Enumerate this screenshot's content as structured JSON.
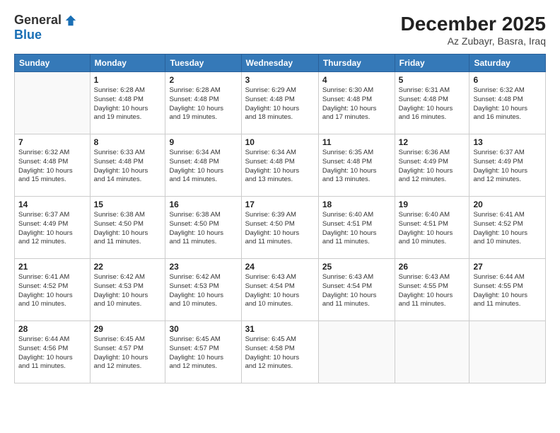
{
  "header": {
    "logo_general": "General",
    "logo_blue": "Blue",
    "month_title": "December 2025",
    "location": "Az Zubayr, Basra, Iraq"
  },
  "days_of_week": [
    "Sunday",
    "Monday",
    "Tuesday",
    "Wednesday",
    "Thursday",
    "Friday",
    "Saturday"
  ],
  "weeks": [
    [
      {
        "day": "",
        "info": ""
      },
      {
        "day": "1",
        "info": "Sunrise: 6:28 AM\nSunset: 4:48 PM\nDaylight: 10 hours\nand 19 minutes."
      },
      {
        "day": "2",
        "info": "Sunrise: 6:28 AM\nSunset: 4:48 PM\nDaylight: 10 hours\nand 19 minutes."
      },
      {
        "day": "3",
        "info": "Sunrise: 6:29 AM\nSunset: 4:48 PM\nDaylight: 10 hours\nand 18 minutes."
      },
      {
        "day": "4",
        "info": "Sunrise: 6:30 AM\nSunset: 4:48 PM\nDaylight: 10 hours\nand 17 minutes."
      },
      {
        "day": "5",
        "info": "Sunrise: 6:31 AM\nSunset: 4:48 PM\nDaylight: 10 hours\nand 16 minutes."
      },
      {
        "day": "6",
        "info": "Sunrise: 6:32 AM\nSunset: 4:48 PM\nDaylight: 10 hours\nand 16 minutes."
      }
    ],
    [
      {
        "day": "7",
        "info": "Sunrise: 6:32 AM\nSunset: 4:48 PM\nDaylight: 10 hours\nand 15 minutes."
      },
      {
        "day": "8",
        "info": "Sunrise: 6:33 AM\nSunset: 4:48 PM\nDaylight: 10 hours\nand 14 minutes."
      },
      {
        "day": "9",
        "info": "Sunrise: 6:34 AM\nSunset: 4:48 PM\nDaylight: 10 hours\nand 14 minutes."
      },
      {
        "day": "10",
        "info": "Sunrise: 6:34 AM\nSunset: 4:48 PM\nDaylight: 10 hours\nand 13 minutes."
      },
      {
        "day": "11",
        "info": "Sunrise: 6:35 AM\nSunset: 4:48 PM\nDaylight: 10 hours\nand 13 minutes."
      },
      {
        "day": "12",
        "info": "Sunrise: 6:36 AM\nSunset: 4:49 PM\nDaylight: 10 hours\nand 12 minutes."
      },
      {
        "day": "13",
        "info": "Sunrise: 6:37 AM\nSunset: 4:49 PM\nDaylight: 10 hours\nand 12 minutes."
      }
    ],
    [
      {
        "day": "14",
        "info": "Sunrise: 6:37 AM\nSunset: 4:49 PM\nDaylight: 10 hours\nand 12 minutes."
      },
      {
        "day": "15",
        "info": "Sunrise: 6:38 AM\nSunset: 4:50 PM\nDaylight: 10 hours\nand 11 minutes."
      },
      {
        "day": "16",
        "info": "Sunrise: 6:38 AM\nSunset: 4:50 PM\nDaylight: 10 hours\nand 11 minutes."
      },
      {
        "day": "17",
        "info": "Sunrise: 6:39 AM\nSunset: 4:50 PM\nDaylight: 10 hours\nand 11 minutes."
      },
      {
        "day": "18",
        "info": "Sunrise: 6:40 AM\nSunset: 4:51 PM\nDaylight: 10 hours\nand 11 minutes."
      },
      {
        "day": "19",
        "info": "Sunrise: 6:40 AM\nSunset: 4:51 PM\nDaylight: 10 hours\nand 10 minutes."
      },
      {
        "day": "20",
        "info": "Sunrise: 6:41 AM\nSunset: 4:52 PM\nDaylight: 10 hours\nand 10 minutes."
      }
    ],
    [
      {
        "day": "21",
        "info": "Sunrise: 6:41 AM\nSunset: 4:52 PM\nDaylight: 10 hours\nand 10 minutes."
      },
      {
        "day": "22",
        "info": "Sunrise: 6:42 AM\nSunset: 4:53 PM\nDaylight: 10 hours\nand 10 minutes."
      },
      {
        "day": "23",
        "info": "Sunrise: 6:42 AM\nSunset: 4:53 PM\nDaylight: 10 hours\nand 10 minutes."
      },
      {
        "day": "24",
        "info": "Sunrise: 6:43 AM\nSunset: 4:54 PM\nDaylight: 10 hours\nand 10 minutes."
      },
      {
        "day": "25",
        "info": "Sunrise: 6:43 AM\nSunset: 4:54 PM\nDaylight: 10 hours\nand 11 minutes."
      },
      {
        "day": "26",
        "info": "Sunrise: 6:43 AM\nSunset: 4:55 PM\nDaylight: 10 hours\nand 11 minutes."
      },
      {
        "day": "27",
        "info": "Sunrise: 6:44 AM\nSunset: 4:55 PM\nDaylight: 10 hours\nand 11 minutes."
      }
    ],
    [
      {
        "day": "28",
        "info": "Sunrise: 6:44 AM\nSunset: 4:56 PM\nDaylight: 10 hours\nand 11 minutes."
      },
      {
        "day": "29",
        "info": "Sunrise: 6:45 AM\nSunset: 4:57 PM\nDaylight: 10 hours\nand 12 minutes."
      },
      {
        "day": "30",
        "info": "Sunrise: 6:45 AM\nSunset: 4:57 PM\nDaylight: 10 hours\nand 12 minutes."
      },
      {
        "day": "31",
        "info": "Sunrise: 6:45 AM\nSunset: 4:58 PM\nDaylight: 10 hours\nand 12 minutes."
      },
      {
        "day": "",
        "info": ""
      },
      {
        "day": "",
        "info": ""
      },
      {
        "day": "",
        "info": ""
      }
    ]
  ]
}
